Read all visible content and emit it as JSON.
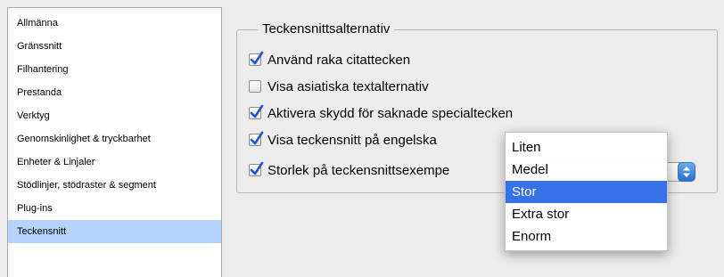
{
  "sidebar": {
    "items": [
      {
        "label": "Allmänna"
      },
      {
        "label": "Gränssnitt"
      },
      {
        "label": "Filhantering"
      },
      {
        "label": "Prestanda"
      },
      {
        "label": "Verktyg"
      },
      {
        "label": "Genomskinlighet & tryckbarhet"
      },
      {
        "label": "Enheter & Linjaler"
      },
      {
        "label": "Stödlinjer, stödraster & segment"
      },
      {
        "label": "Plug-ins"
      },
      {
        "label": "Teckensnitt"
      }
    ],
    "selected": "Teckensnitt"
  },
  "font_options": {
    "group_title": "Teckensnittsalternativ",
    "options": [
      {
        "label": "Använd raka citattecken",
        "checked": true
      },
      {
        "label": "Visa asiatiska textalternativ",
        "checked": false
      },
      {
        "label": "Aktivera skydd för saknade specialtecken",
        "checked": true
      },
      {
        "label": "Visa teckensnitt på engelska",
        "checked": true
      },
      {
        "label": "Storlek på teckensnittsexempe",
        "checked": true
      }
    ]
  },
  "size_dropdown": {
    "options": [
      "Liten",
      "Medel",
      "Stor",
      "Extra stor",
      "Enorm"
    ],
    "selected": "Stor"
  },
  "colors": {
    "sidebar_selection": "#b5d4fd",
    "menu_highlight": "#3671e8",
    "checkbox_check": "#1d58c9"
  }
}
